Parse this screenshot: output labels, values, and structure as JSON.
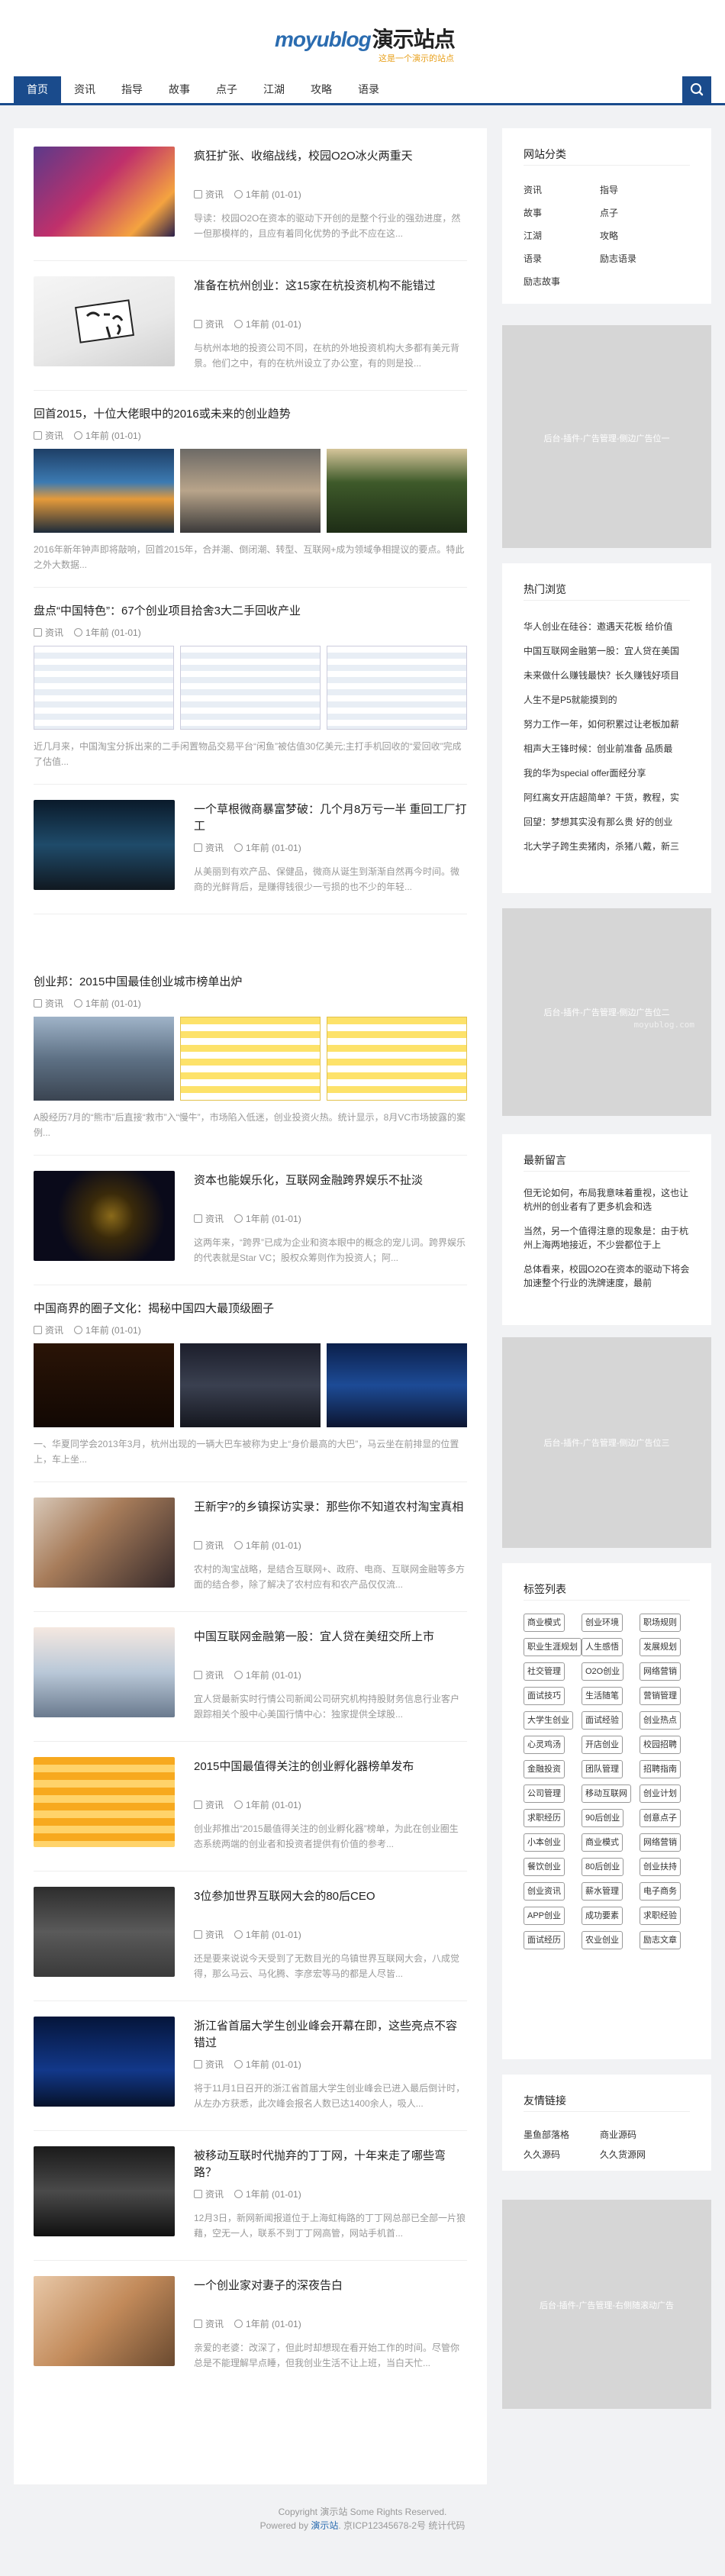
{
  "site": {
    "logo_en": "moyublog",
    "logo_cn": "演示站点",
    "logo_sub": "这是一个演示的站点"
  },
  "nav": [
    "首页",
    "资讯",
    "指导",
    "故事",
    "点子",
    "江湖",
    "攻略",
    "语录"
  ],
  "posts": [
    {
      "title": "疯狂扩张、收缩战线，校园O2O冰火两重天",
      "cat": "资讯",
      "time": "1年前 (01-01)",
      "excerpt": "导读：校园O2O在资本的驱动下开创的是整个行业的强劲进度，然一但那模样的，且应有着同化优势的予此不应在这..."
    },
    {
      "title": "准备在杭州创业：这15家在杭投资机构不能错过",
      "cat": "资讯",
      "time": "1年前 (01-01)",
      "excerpt": "与杭州本地的投资公司不同，在杭的外地投资机构大多都有美元背景。他们之中，有的在杭州设立了办公室，有的则是投..."
    },
    {
      "title": "回首2015，十位大佬眼中的2016或未来的创业趋势",
      "cat": "资讯",
      "time": "1年前 (01-01)",
      "excerpt": "2016年新年钟声即将敲响，回首2015年，合并潮、倒闭潮、转型、互联网+成为领域争相提议的要点。特此之外大数据..."
    },
    {
      "title": "盘点“中国特色”：67个创业项目拾舍3大二手回收产业",
      "cat": "资讯",
      "time": "1年前 (01-01)",
      "excerpt": "近几月来，中国淘宝分拆出来的二手闲置物品交易平台“闲鱼”被估值30亿美元;主打手机回收的“爱回收”完成了估值..."
    },
    {
      "title": "一个草根微商暴富梦破：几个月8万亏一半 重回工厂打工",
      "cat": "资讯",
      "time": "1年前 (01-01)",
      "excerpt": "从美丽到有欢产品、保健品，微商从诞生到渐渐自然再今时间。微商的光鲜背后，是赚得钱很少一亏损的也不少的年轻..."
    },
    {
      "title": "创业邦：2015中国最佳创业城市榜单出炉",
      "cat": "资讯",
      "time": "1年前 (01-01)",
      "excerpt": "A股经历7月的“熊市”后直接“救市”入“慢牛”，市场陷入低迷，创业投资火热。统计显示，8月VC市场披露的案例..."
    },
    {
      "title": "资本也能娱乐化，互联网金融跨界娱乐不扯淡",
      "cat": "资讯",
      "time": "1年前 (01-01)",
      "excerpt": "这两年来，“跨界”已成为企业和资本眼中的概念的宠儿词。跨界娱乐的代表就是Star VC；股权众筹则作为投资人；阿..."
    },
    {
      "title": "中国商界的圈子文化：揭秘中国四大最顶级圈子",
      "cat": "资讯",
      "time": "1年前 (01-01)",
      "excerpt": "一、华夏同学会2013年3月，杭州出现的一辆大巴车被称为史上“身价最高的大巴”，马云坐在前排显的位置上，车上坐..."
    },
    {
      "title": "王新宇?的乡镇探访实录：那些你不知道农村淘宝真相",
      "cat": "资讯",
      "time": "1年前 (01-01)",
      "excerpt": "农村的淘宝战略，是结合互联网+、政府、电商、互联网金融等多方面的结合参，除了解决了农村应有和农产品仅仅流..."
    },
    {
      "title": "中国互联网金融第一股：宜人贷在美纽交所上市",
      "cat": "资讯",
      "time": "1年前 (01-01)",
      "excerpt": "宜人贷最新实时行情公司新闻公司研究机构持股财务信息行业客户跟踪相关个股中心美国行情中心：独家提供全球股..."
    },
    {
      "title": "2015中国最值得关注的创业孵化器榜单发布",
      "cat": "资讯",
      "time": "1年前 (01-01)",
      "excerpt": "创业邦推出“2015最值得关注的创业孵化器”榜单，为此在创业圈生态系统两端的创业者和投资者提供有价值的参考..."
    },
    {
      "title": "3位参加世界互联网大会的80后CEO",
      "cat": "资讯",
      "time": "1年前 (01-01)",
      "excerpt": "还是要来说说今天受到了无数目光的乌镇世界互联网大会，八成觉得，那么马云、马化腾、李彦宏等马的都是人尽皆..."
    },
    {
      "title": "浙江省首届大学生创业峰会开幕在即，这些亮点不容错过",
      "cat": "资讯",
      "time": "1年前 (01-01)",
      "excerpt": "将于11月1日召开的浙江省首届大学生创业峰会已进入最后倒计时，从左办方获悉，此次峰会报名人数已达1400余人，吸人..."
    },
    {
      "title": "被移动互联时代抛弃的丁丁网，十年来走了哪些弯路？",
      "cat": "资讯",
      "time": "1年前 (01-01)",
      "excerpt": "12月3日，新网新闻报道位于上海虹梅路的丁丁网总部已全部一片狼藉，空无一人，联系不到丁丁网高管，网站手机首..."
    },
    {
      "title": "一个创业家对妻子的深夜告白",
      "cat": "资讯",
      "time": "1年前 (01-01)",
      "excerpt": "亲爱的老婆：改深了，但此时却想现在看开始工作的时间。尽管你总是不能理解早点睡，但我创业生活不让上班，当白天忙..."
    }
  ],
  "sidebar": {
    "categories": {
      "title": "网站分类",
      "items": [
        "资讯",
        "指导",
        "故事",
        "点子",
        "江湖",
        "攻略",
        "语录",
        "励志语录",
        "励志故事"
      ]
    },
    "ad_text": "后台-插件-广告管理-侧边广告位一",
    "ad_text_2": "后台-插件-广告管理-侧边广告位二",
    "ad_text_3": "后台-插件-广告管理-侧边广告位三",
    "ad_text_4": "后台-插件-广告管理-右侧随滚动广告",
    "watermark": "moyublog.com",
    "hot": {
      "title": "热门浏览",
      "items": [
        "华人创业在硅谷：邀遇天花板 给价值",
        "中国互联网金融第一股：宜人贷在美国",
        "未来做什么赚钱最快？长久赚钱好项目",
        "人生不是P5就能摸到的",
        "努力工作一年，如何积累过让老板加薪",
        "相声大王锋时候：创业前准备 品质最",
        "我的华为special offer面经分享",
        "阿红离女开店超简单？干货，教程，实",
        "回望：梦想其实没有那么贵 好的创业",
        "北大学子跨生卖猪肉，杀猪八戴，新三"
      ]
    },
    "comments": {
      "title": "最新留言",
      "items": [
        "但无论如何，布局我意味着重视，这也让杭州的创业者有了更多机会和选",
        "当然，另一个值得注意的现象是：由于杭州上海两地接近，不少尝都位于上",
        "总体看来，校园O2O在资本的驱动下将会加速整个行业的洗牌速度，最前"
      ]
    },
    "tags": {
      "title": "标签列表",
      "items": [
        "商业模式",
        "创业环境",
        "职场规则",
        "职业生涯规划",
        "人生感悟",
        "发展规划",
        "社交管理",
        "O2O创业",
        "网络营销",
        "面试技巧",
        "生活随笔",
        "营销管理",
        "大学生创业",
        "面试经验",
        "创业热点",
        "心灵鸡汤",
        "开店创业",
        "校园招聘",
        "金融投资",
        "团队管理",
        "招聘指南",
        "公司管理",
        "移动互联网",
        "创业计划",
        "求职经历",
        "90后创业",
        "创意点子",
        "小本创业",
        "商业模式",
        "网络营销",
        "餐饮创业",
        "80后创业",
        "创业扶持",
        "创业资讯",
        "薪水管理",
        "电子商务",
        "APP创业",
        "成功要素",
        "求职经验",
        "面试经历",
        "农业创业",
        "励志文章"
      ]
    },
    "links": {
      "title": "友情链接",
      "items": [
        "墨鱼部落格",
        "商业源码",
        "久久源码",
        "久久货源网"
      ]
    }
  },
  "footer": {
    "line1": "Copyright 演示站 Some Rights Reserved.",
    "line2_a": "Powered by",
    "line2_b": "演示站",
    "line2_c": ". 京ICP12345678-2号 统计代码"
  }
}
